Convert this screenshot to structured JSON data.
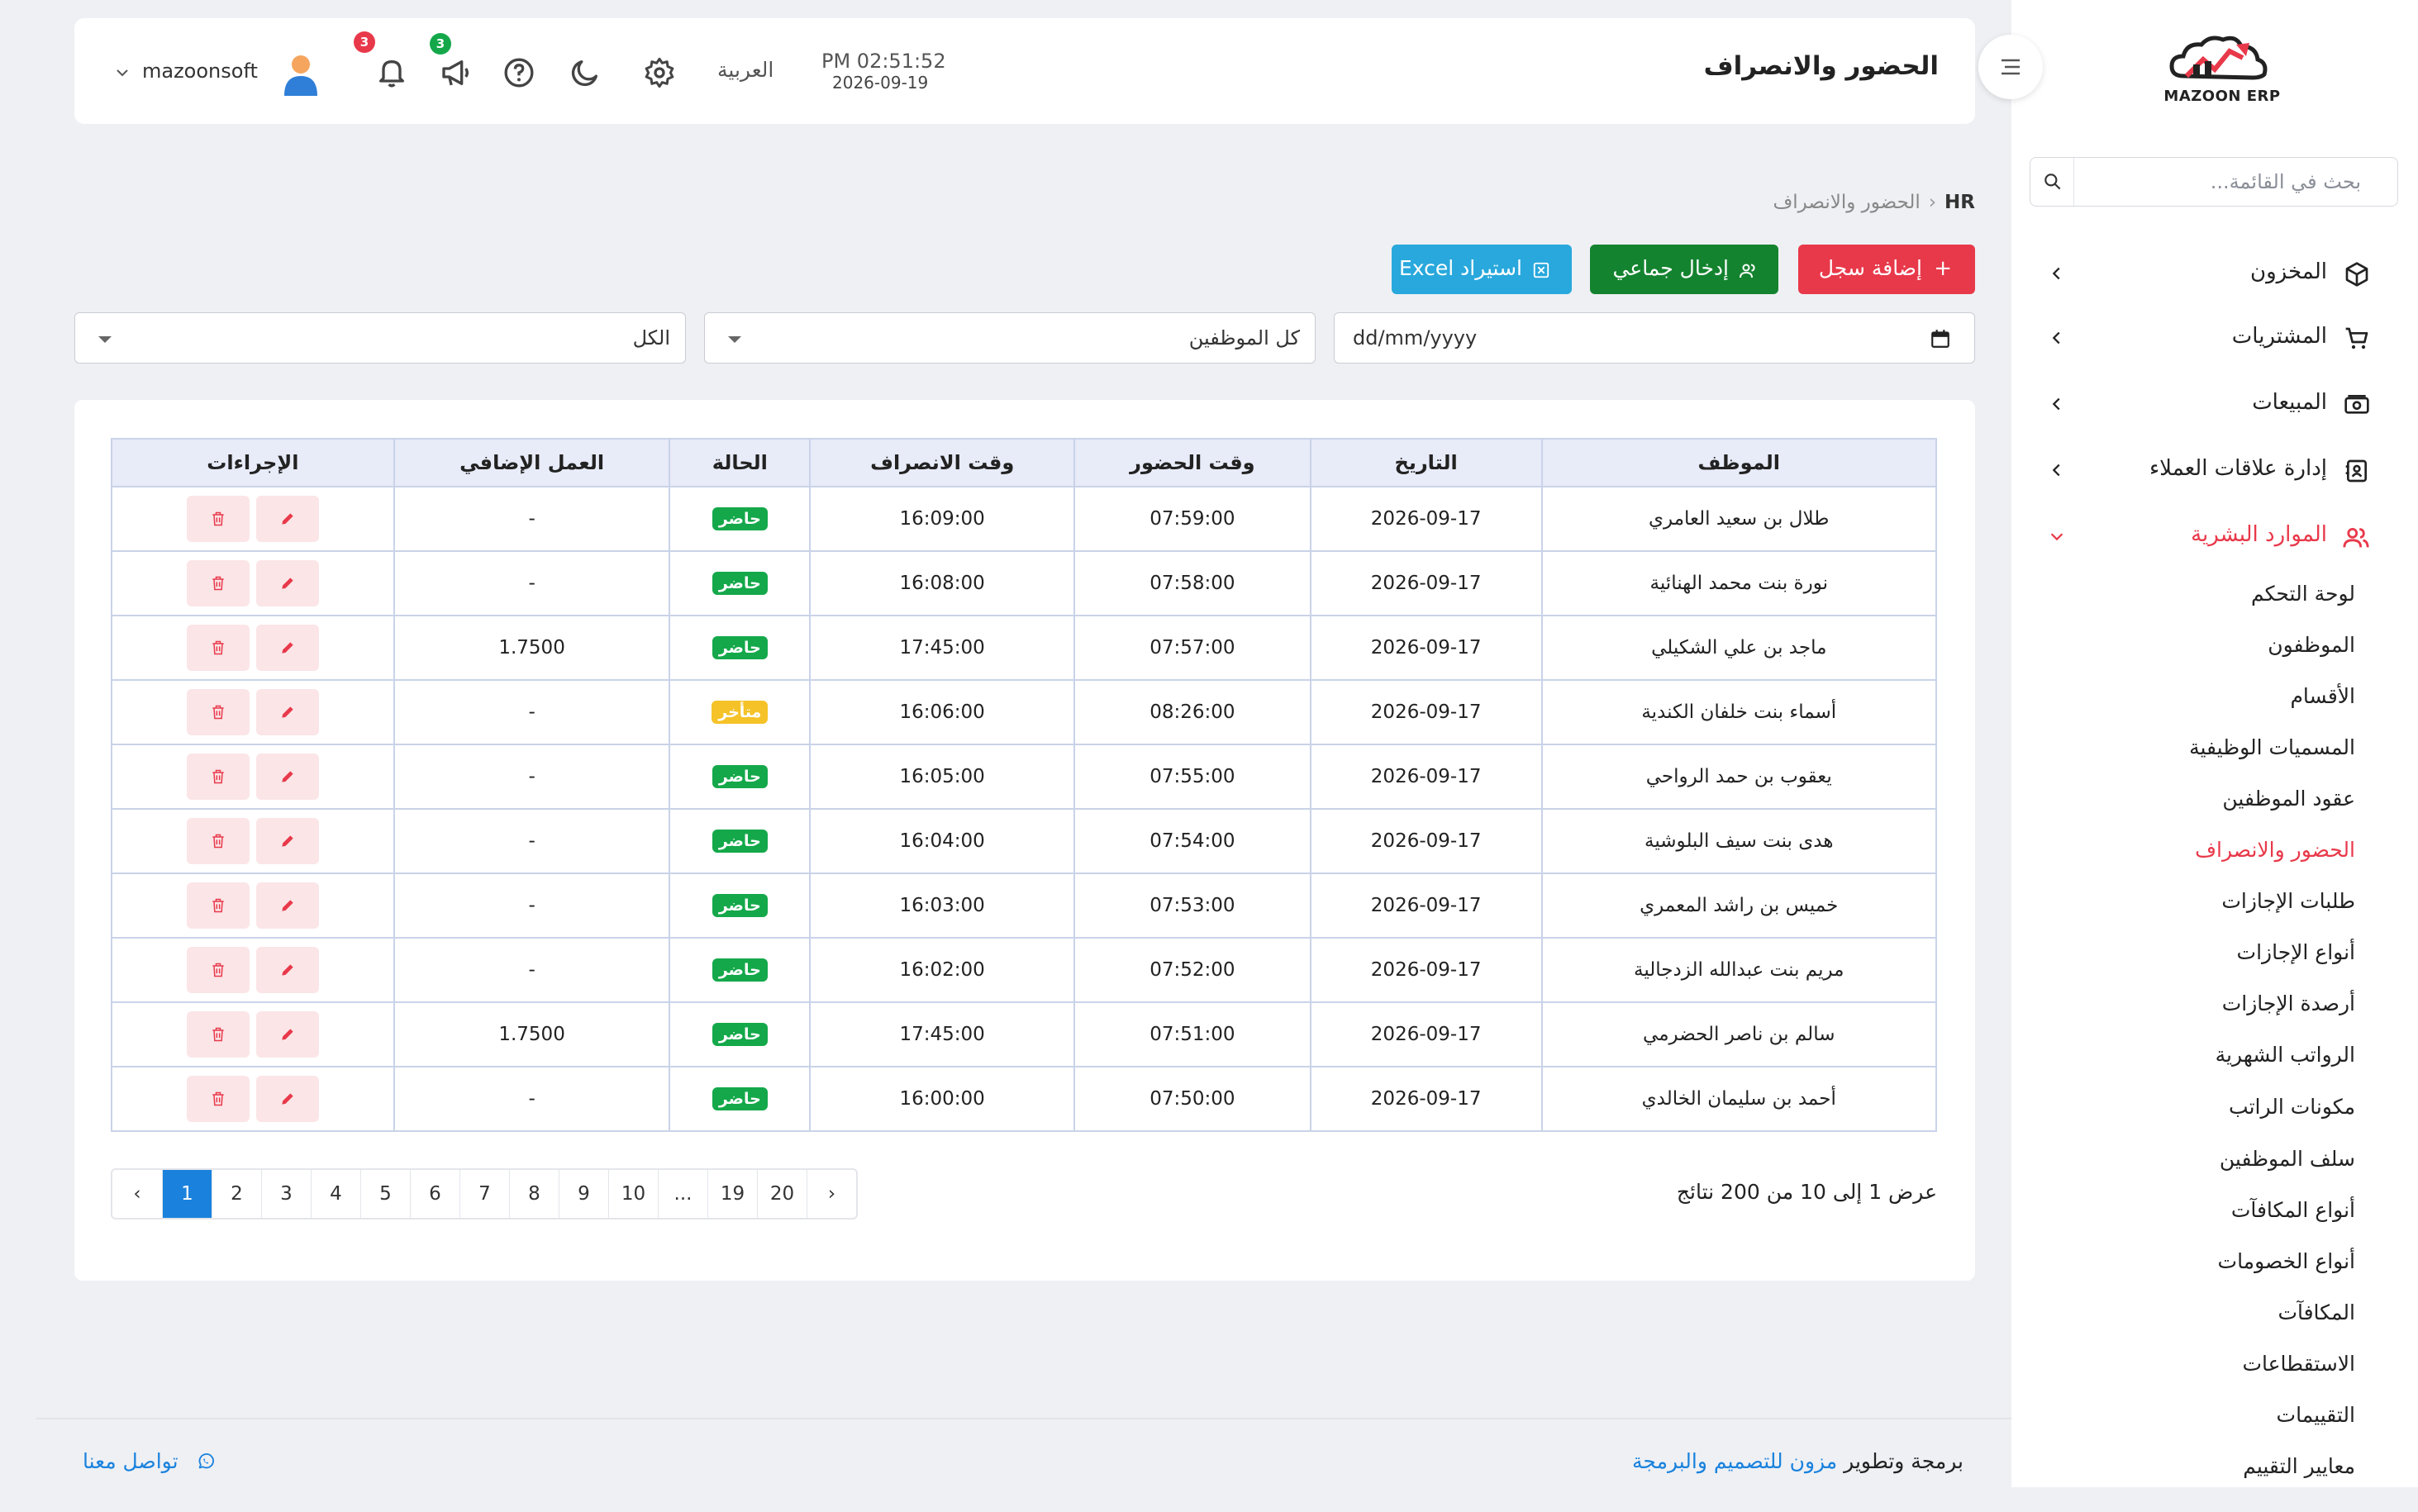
{
  "header": {
    "page_title": "الحضور والانصراف",
    "time": "PM 02:51:52",
    "date": "2026-09-19",
    "language": "العربية",
    "notifications_badge": "3",
    "announcements_badge": "3",
    "username": "mazoonsoft"
  },
  "sidebar": {
    "logo_text": "MAZOON ERP",
    "search_placeholder": "بحث في القائمة...",
    "main_items": [
      {
        "label": "المخزون",
        "icon": "box-icon"
      },
      {
        "label": "المشتريات",
        "icon": "cart-icon"
      },
      {
        "label": "المبيعات",
        "icon": "cash-icon"
      },
      {
        "label": "إدارة علاقات العملاء",
        "icon": "contacts-icon"
      },
      {
        "label": "الموارد البشرية",
        "icon": "users-icon",
        "active": true
      }
    ],
    "sub_items": [
      "لوحة التحكم",
      "الموظفون",
      "الأقسام",
      "المسميات الوظيفية",
      "عقود الموظفين",
      "الحضور والانصراف",
      "طلبات الإجازات",
      "أنواع الإجازات",
      "أرصدة الإجازات",
      "الرواتب الشهرية",
      "مكونات الراتب",
      "سلف الموظفين",
      "أنواع المكافآت",
      "أنواع الخصومات",
      "المكافآت",
      "الاستقطاعات",
      "التقييمات",
      "معايير التقييم"
    ],
    "active_sub_index": 5
  },
  "breadcrumb": {
    "root": "HR",
    "current": "الحضور والانصراف"
  },
  "actions": {
    "add": "إضافة سجل",
    "bulk": "إدخال جماعي",
    "excel": "استيراد Excel"
  },
  "filters": {
    "date_placeholder": "dd/mm/yyyy",
    "employee": "كل الموظفين",
    "status": "الكل"
  },
  "table": {
    "headers": [
      "الموظف",
      "التاريخ",
      "وقت الحضور",
      "وقت الانصراف",
      "الحالة",
      "العمل الإضافي",
      "الإجراءات"
    ],
    "rows": [
      {
        "employee": "طلال بن سعيد العامري",
        "date": "2026-09-17",
        "check_in": "07:59:00",
        "check_out": "16:09:00",
        "status": "حاضر",
        "status_type": "present",
        "overtime": "-"
      },
      {
        "employee": "نورة بنت محمد الهنائية",
        "date": "2026-09-17",
        "check_in": "07:58:00",
        "check_out": "16:08:00",
        "status": "حاضر",
        "status_type": "present",
        "overtime": "-"
      },
      {
        "employee": "ماجد بن علي الشكيلي",
        "date": "2026-09-17",
        "check_in": "07:57:00",
        "check_out": "17:45:00",
        "status": "حاضر",
        "status_type": "present",
        "overtime": "1.7500"
      },
      {
        "employee": "أسماء بنت خلفان الكندية",
        "date": "2026-09-17",
        "check_in": "08:26:00",
        "check_out": "16:06:00",
        "status": "متأخر",
        "status_type": "late",
        "overtime": "-"
      },
      {
        "employee": "يعقوب بن حمد الرواحي",
        "date": "2026-09-17",
        "check_in": "07:55:00",
        "check_out": "16:05:00",
        "status": "حاضر",
        "status_type": "present",
        "overtime": "-"
      },
      {
        "employee": "هدى بنت سيف البلوشية",
        "date": "2026-09-17",
        "check_in": "07:54:00",
        "check_out": "16:04:00",
        "status": "حاضر",
        "status_type": "present",
        "overtime": "-"
      },
      {
        "employee": "خميس بن راشد المعمري",
        "date": "2026-09-17",
        "check_in": "07:53:00",
        "check_out": "16:03:00",
        "status": "حاضر",
        "status_type": "present",
        "overtime": "-"
      },
      {
        "employee": "مريم بنت عبدالله الزدجالية",
        "date": "2026-09-17",
        "check_in": "07:52:00",
        "check_out": "16:02:00",
        "status": "حاضر",
        "status_type": "present",
        "overtime": "-"
      },
      {
        "employee": "سالم بن ناصر الحضرمي",
        "date": "2026-09-17",
        "check_in": "07:51:00",
        "check_out": "17:45:00",
        "status": "حاضر",
        "status_type": "present",
        "overtime": "1.7500"
      },
      {
        "employee": "أحمد بن سليمان الخالدي",
        "date": "2026-09-17",
        "check_in": "07:50:00",
        "check_out": "16:00:00",
        "status": "حاضر",
        "status_type": "present",
        "overtime": "-"
      }
    ]
  },
  "pagination": {
    "summary": "عرض 1 إلى 10 من 200 نتائج",
    "pages": [
      "‹",
      "1",
      "2",
      "3",
      "4",
      "5",
      "6",
      "7",
      "8",
      "9",
      "10",
      "...",
      "19",
      "20",
      "›"
    ],
    "active": "1"
  },
  "footer": {
    "prefix": "برمجة وتطوير",
    "company": "مزون للتصميم والبرمجة",
    "contact": "تواصل معنا"
  },
  "colors": {
    "accent": "#e8394a",
    "primary": "#1a82dd",
    "success": "#14832f",
    "info": "#28a8dc",
    "warning": "#f5c228"
  }
}
